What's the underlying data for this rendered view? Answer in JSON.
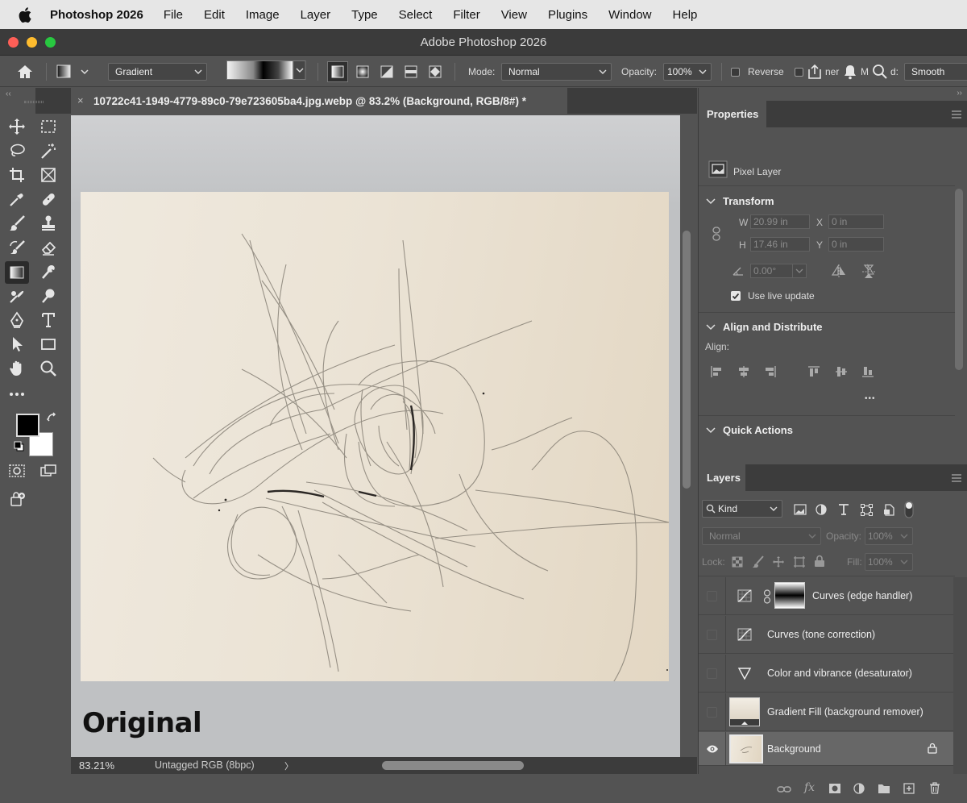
{
  "menubar": {
    "app_name": "Photoshop 2026",
    "items": [
      "File",
      "Edit",
      "Image",
      "Layer",
      "Type",
      "Select",
      "Filter",
      "View",
      "Plugins",
      "Window",
      "Help"
    ]
  },
  "window": {
    "title": "Adobe Photoshop 2026"
  },
  "options": {
    "preset": "Gradient",
    "mode_label": "Mode:",
    "mode_value": "Normal",
    "opacity_label": "Opacity:",
    "opacity_value": "100%",
    "reverse_label": "Reverse",
    "dither_fragment": "ner",
    "method_fragment": "M",
    "method_value_prefix": "d:",
    "method_value": "Smooth"
  },
  "document": {
    "tab_title": "10722c41-1949-4779-89c0-79e723605ba4.jpg.webp @ 83.2% (Background, RGB/8#) *",
    "close_glyph": "×",
    "canvas_caption": "Original",
    "zoom": "83.21%",
    "profile": "Untagged RGB (8bpc)",
    "status_arrow": "〉"
  },
  "properties": {
    "tab": "Properties",
    "layer_kind": "Pixel Layer",
    "transform": {
      "title": "Transform",
      "w_label": "W",
      "w_value": "20.99 in",
      "h_label": "H",
      "h_value": "17.46 in",
      "x_label": "X",
      "x_value": "0 in",
      "y_label": "Y",
      "y_value": "0 in",
      "angle_value": "0.00°",
      "live_update_label": "Use live update",
      "live_update_checked": true
    },
    "align": {
      "title": "Align and Distribute",
      "align_label": "Align:",
      "more": "•••"
    },
    "quick_actions": {
      "title": "Quick Actions"
    }
  },
  "layers": {
    "tab": "Layers",
    "filter_kind": "Kind",
    "blend_mode": "Normal",
    "opacity_label": "Opacity:",
    "opacity_value": "100%",
    "lock_label": "Lock:",
    "fill_label": "Fill:",
    "fill_value": "100%",
    "rows": [
      {
        "name": "Curves (edge handler)",
        "visible": false
      },
      {
        "name": "Curves (tone correction)",
        "visible": false
      },
      {
        "name": "Color and vibrance (desaturator)",
        "visible": false
      },
      {
        "name": "Gradient Fill (background remover)",
        "visible": false
      },
      {
        "name": "Background",
        "visible": true,
        "selected": true,
        "locked": true
      }
    ]
  },
  "colors": {
    "foreground": "#000000",
    "background": "#ffffff",
    "panel": "#535353",
    "paper": "#ece4d6"
  }
}
